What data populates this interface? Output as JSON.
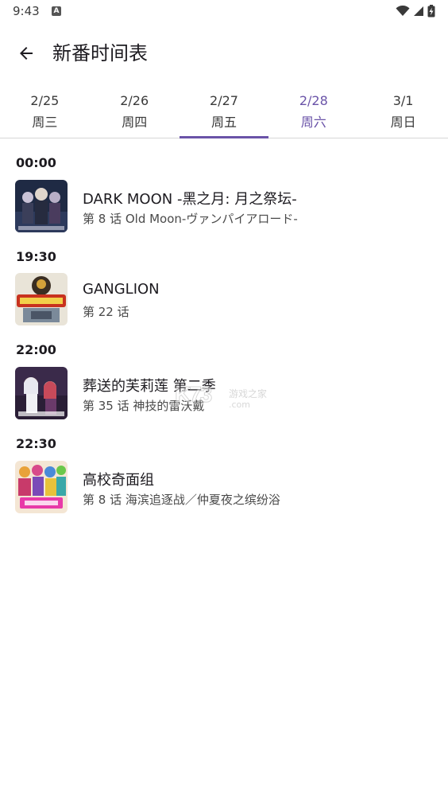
{
  "status_bar": {
    "time": "9:43",
    "app_icon_letter": "A"
  },
  "header": {
    "title": "新番时间表"
  },
  "tabs": [
    {
      "date": "2/25",
      "day": "周三"
    },
    {
      "date": "2/26",
      "day": "周四"
    },
    {
      "date": "2/27",
      "day": "周五"
    },
    {
      "date": "2/28",
      "day": "周六"
    },
    {
      "date": "3/1",
      "day": "周日"
    }
  ],
  "selected_tab": "2/27",
  "highlighted_tab": "2/28",
  "schedule": [
    {
      "time": "00:00",
      "title": "DARK MOON -黑之月: 月之祭坛-",
      "subtitle": "第 8 话  Old Moon-ヴァンパイアロード-"
    },
    {
      "time": "19:30",
      "title": "GANGLION",
      "subtitle": "第 22 话"
    },
    {
      "time": "22:00",
      "title": "葬送的芙莉莲 第二季",
      "subtitle": "第 35 话  神技的雷沃戴"
    },
    {
      "time": "22:30",
      "title": "高校奇面组",
      "subtitle": "第 8 话  海滨追逐战／仲夏夜之缤纷浴"
    }
  ],
  "watermark": {
    "mark": "K73",
    "text": "游戏之家",
    "domain": ".com"
  },
  "colors": {
    "accent": "#6a53a8",
    "divider": "#d6d6d6"
  }
}
